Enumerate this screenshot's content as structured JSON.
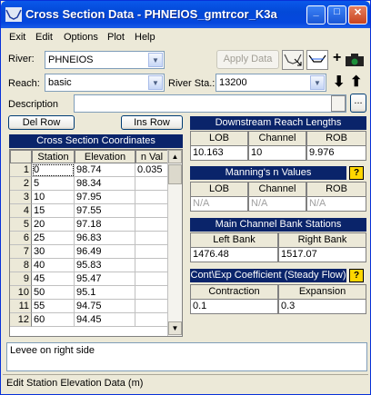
{
  "window": {
    "title": "Cross Section Data - PHNEIOS_gmtrcor_K3a",
    "controls": {
      "minimize": "_",
      "maximize": "□",
      "close": "✕"
    }
  },
  "menu": [
    "Exit",
    "Edit",
    "Options",
    "Plot",
    "Help"
  ],
  "river": {
    "label": "River:",
    "value": "PHNEIOS"
  },
  "reach": {
    "label": "Reach:",
    "value": "basic"
  },
  "river_sta": {
    "label": "River Sta.:",
    "value": "13200"
  },
  "apply_data": "Apply Data",
  "description": {
    "label": "Description",
    "value": ""
  },
  "del_row": "Del Row",
  "ins_row": "Ins Row",
  "coords": {
    "title": "Cross Section Coordinates",
    "headers": [
      "Station",
      "Elevation",
      "n Val"
    ],
    "rows": [
      {
        "n": "1",
        "station": "0",
        "elevation": "98.74",
        "nval": "0.035"
      },
      {
        "n": "2",
        "station": "5",
        "elevation": "98.34",
        "nval": ""
      },
      {
        "n": "3",
        "station": "10",
        "elevation": "97.95",
        "nval": ""
      },
      {
        "n": "4",
        "station": "15",
        "elevation": "97.55",
        "nval": ""
      },
      {
        "n": "5",
        "station": "20",
        "elevation": "97.18",
        "nval": ""
      },
      {
        "n": "6",
        "station": "25",
        "elevation": "96.83",
        "nval": ""
      },
      {
        "n": "7",
        "station": "30",
        "elevation": "96.49",
        "nval": ""
      },
      {
        "n": "8",
        "station": "40",
        "elevation": "95.83",
        "nval": ""
      },
      {
        "n": "9",
        "station": "45",
        "elevation": "95.47",
        "nval": ""
      },
      {
        "n": "10",
        "station": "50",
        "elevation": "95.1",
        "nval": ""
      },
      {
        "n": "11",
        "station": "55",
        "elevation": "94.75",
        "nval": ""
      },
      {
        "n": "12",
        "station": "60",
        "elevation": "94.45",
        "nval": ""
      }
    ]
  },
  "downstream": {
    "title": "Downstream Reach Lengths",
    "headers": [
      "LOB",
      "Channel",
      "ROB"
    ],
    "values": [
      "10.163",
      "10",
      "9.976"
    ]
  },
  "mannings": {
    "title": "Manning's n Values",
    "help": "?",
    "headers": [
      "LOB",
      "Channel",
      "ROB"
    ],
    "values": [
      "N/A",
      "N/A",
      "N/A"
    ]
  },
  "bank_stations": {
    "title": "Main Channel Bank Stations",
    "headers": [
      "Left Bank",
      "Right Bank"
    ],
    "values": [
      "1476.48",
      "1517.07"
    ]
  },
  "contexp": {
    "title": "Cont\\Exp Coefficient (Steady Flow)",
    "help": "?",
    "headers": [
      "Contraction",
      "Expansion"
    ],
    "values": [
      "0.1",
      "0.3"
    ]
  },
  "notes": "Levee on right side",
  "status": "Edit Station Elevation Data (m)"
}
